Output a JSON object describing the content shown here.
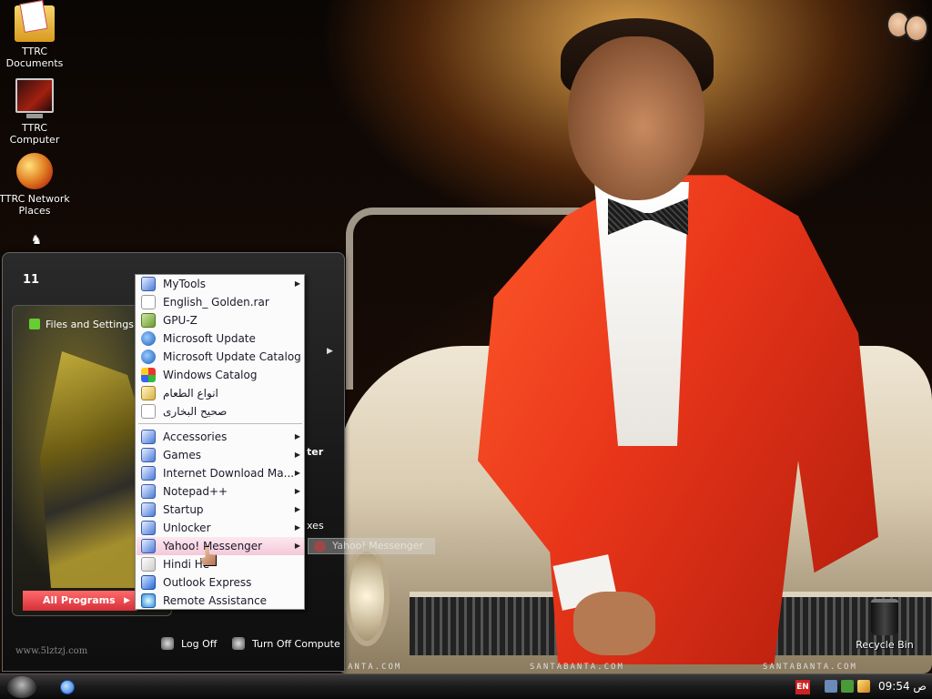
{
  "desktop": {
    "icons": [
      {
        "label": "TTRC Documents",
        "icon": "documents-folder-icon"
      },
      {
        "label": "TTRC Computer",
        "icon": "computer-icon"
      },
      {
        "label": "TTRC Network Places",
        "icon": "network-places-icon"
      },
      {
        "label": "Recycle Bin",
        "icon": "recycle-bin-icon"
      }
    ]
  },
  "wallpaper": {
    "watermarks": [
      "ANTA.COM",
      "SANTABANTA.COM",
      "SANTABANTA.COM"
    ]
  },
  "start_menu": {
    "user_name": "11",
    "files_settings_label": "Files and Settings Tra",
    "all_programs_label": "All Programs",
    "site_text": "www.5lztzj.com",
    "right_fragments": [
      "ter",
      "xes"
    ],
    "log_off_label": "Log Off",
    "turn_off_label": "Turn Off Compute"
  },
  "programs_menu": {
    "items": [
      {
        "label": "MyTools",
        "icon": "folder-icon",
        "submenu": true
      },
      {
        "label": "English_ Golden.rar",
        "icon": "file-icon",
        "submenu": false
      },
      {
        "label": "GPU-Z",
        "icon": "gpuz-icon",
        "submenu": false
      },
      {
        "label": "Microsoft Update",
        "icon": "globe-icon",
        "submenu": false
      },
      {
        "label": "Microsoft Update Catalog",
        "icon": "globe-icon",
        "submenu": false
      },
      {
        "label": "Windows Catalog",
        "icon": "windows-icon",
        "submenu": false
      },
      {
        "label": "انواع الطعام",
        "icon": "book-icon",
        "submenu": false
      },
      {
        "label": "صحيح البخارى",
        "icon": "file-icon",
        "submenu": false
      },
      {
        "label": "Accessories",
        "icon": "folder-icon",
        "submenu": true
      },
      {
        "label": "Games",
        "icon": "folder-icon",
        "submenu": true
      },
      {
        "label": "Internet Download Ma...",
        "icon": "folder-icon",
        "submenu": true
      },
      {
        "label": "Notepad++",
        "icon": "folder-icon",
        "submenu": true
      },
      {
        "label": "Startup",
        "icon": "folder-icon",
        "submenu": true
      },
      {
        "label": "Unlocker",
        "icon": "folder-icon",
        "submenu": true
      },
      {
        "label": "Yahoo! Messenger",
        "icon": "folder-icon",
        "submenu": true
      },
      {
        "label": "Hindi He",
        "icon": "pen-icon",
        "submenu": false
      },
      {
        "label": "Outlook Express",
        "icon": "mail-icon",
        "submenu": false
      },
      {
        "label": "Remote Assistance",
        "icon": "remote-assistance-icon",
        "submenu": false
      }
    ],
    "highlighted": "Yahoo! Messenger"
  },
  "drag_ghost": {
    "label": "Yahoo! Messenger"
  },
  "taskbar": {
    "language": "EN",
    "clock": "09:54 ص"
  }
}
